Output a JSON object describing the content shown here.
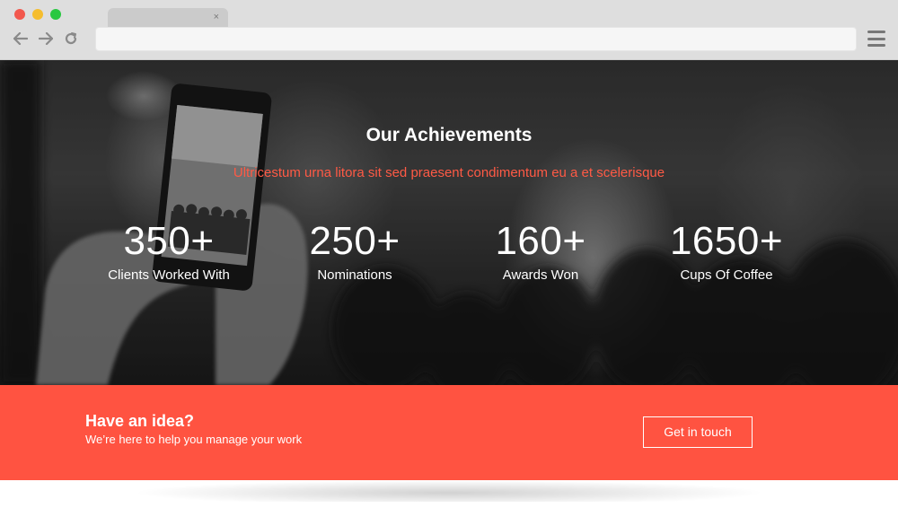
{
  "browser": {
    "colors": {
      "red": "#f2584d",
      "yellow": "#f5bd2e",
      "green": "#28c840"
    },
    "tab": {
      "close_glyph": "×"
    },
    "address": {
      "value": ""
    },
    "icons": [
      "back-arrow-icon",
      "forward-arrow-icon",
      "reload-icon",
      "hamburger-menu-icon"
    ]
  },
  "hero": {
    "title": "Our Achievements",
    "subtitle": "Ultricestum urna litora sit sed praesent condimentum eu a et scelerisque",
    "stats": [
      {
        "value": "350+",
        "label": "Clients Worked With"
      },
      {
        "value": "250+",
        "label": "Nominations"
      },
      {
        "value": "160+",
        "label": "Awards Won"
      },
      {
        "value": "1650+",
        "label": "Cups Of Coffee"
      }
    ]
  },
  "cta": {
    "title": "Have an idea?",
    "text": "We’re here to help you manage your work",
    "button_label": "Get in touch",
    "color": "#ff5341"
  },
  "theme": {
    "accent": "#ff5a45"
  }
}
